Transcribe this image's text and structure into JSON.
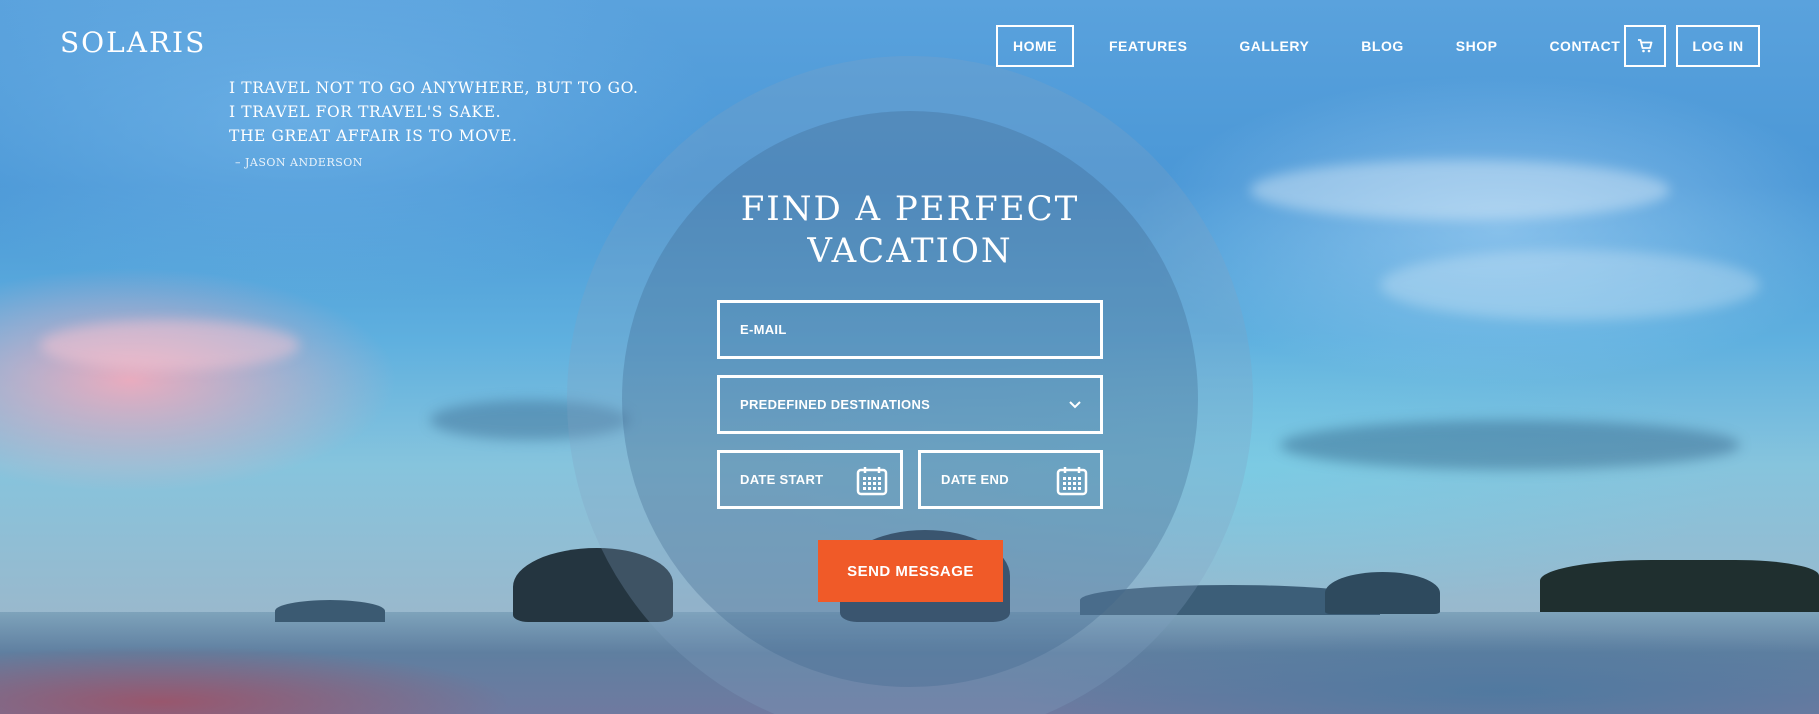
{
  "header": {
    "logo": "SOLARIS",
    "nav": [
      {
        "label": "HOME",
        "active": true
      },
      {
        "label": "FEATURES",
        "active": false
      },
      {
        "label": "GALLERY",
        "active": false
      },
      {
        "label": "BLOG",
        "active": false
      },
      {
        "label": "SHOP",
        "active": false
      },
      {
        "label": "CONTACT",
        "active": false
      }
    ],
    "cart_icon": "cart-icon",
    "login_label": "LOG IN"
  },
  "quote": {
    "lines": [
      "I TRAVEL NOT TO GO ANYWHERE, BUT TO GO.",
      "I TRAVEL FOR TRAVEL'S SAKE.",
      "THE GREAT AFFAIR IS TO MOVE."
    ],
    "author": "– JASON ANDERSON"
  },
  "form": {
    "title_line1": "FIND A PERFECT",
    "title_line2": "VACATION",
    "email_placeholder": "E-MAIL",
    "destination_value": "PREDEFINED DESTINATIONS",
    "destination_icon": "chevron-down-icon",
    "date_start_placeholder": "DATE START",
    "date_end_placeholder": "DATE END",
    "date_icon": "calendar-icon",
    "submit_label": "SEND MESSAGE"
  },
  "colors": {
    "accent": "#f05a28",
    "text": "#ffffff"
  }
}
